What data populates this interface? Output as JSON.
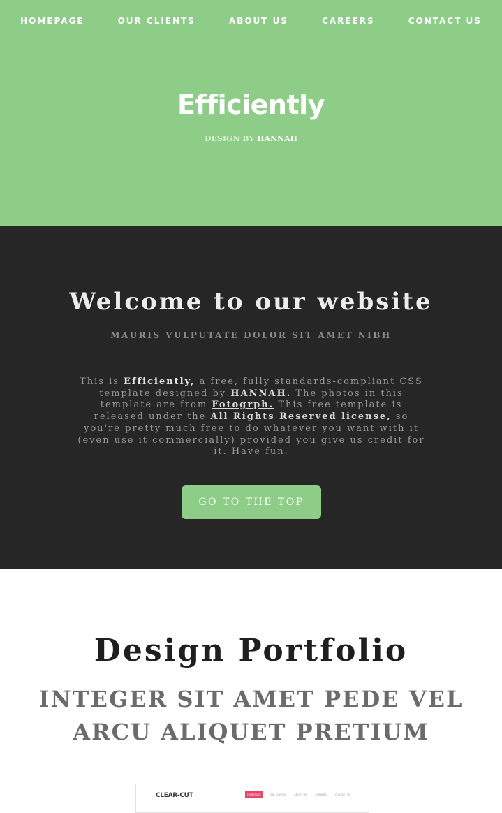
{
  "nav": {
    "items": [
      "HOMEPAGE",
      "OUR CLIENTS",
      "ABOUT US",
      "CAREERS",
      "CONTACT US"
    ]
  },
  "hero": {
    "title": "Efficiently",
    "design_by": "DESIGN BY",
    "author": "HANNAH"
  },
  "welcome": {
    "title": "Welcome to our website",
    "subtitle": "MAURIS VULPUTATE DOLOR SIT AMET NIBH",
    "body": {
      "t1": "This is ",
      "brand": "Efficiently,",
      "t2": " a free, fully standards-compliant CSS template designed by ",
      "link_author": "HANNAH.",
      "t3": " The photos in this template are from ",
      "link_photos": "Fotogrph.",
      "t4": " This free template is released under the ",
      "link_license": "All Rights Reserved license,",
      "t5": " so you're pretty much free to do whatever you want with it (even use it commercially) provided you give us credit for it. Have fun."
    },
    "button": "GO TO THE TOP"
  },
  "portfolio": {
    "title": "Design Portfolio",
    "subtitle": "INTEGER SIT AMET PEDE VEL ARCU ALIQUET PRETIUM",
    "thumb": {
      "brand": "CLEAR-CUT",
      "tabs": [
        "HOMEPAGE",
        "OUR CLIENTS",
        "ABOUT US",
        "CAREERS",
        "CONTACT US"
      ]
    }
  },
  "colors": {
    "accent_green": "#8ecd88",
    "dark_bg": "#262626",
    "thumb_active": "#e8446a"
  }
}
